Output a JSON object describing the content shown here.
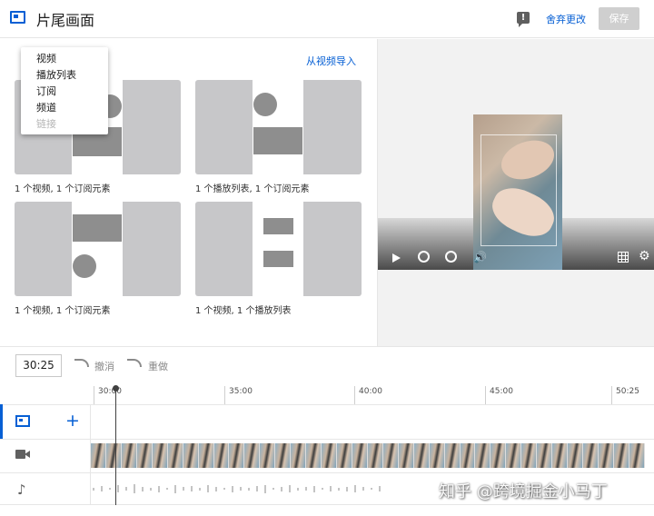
{
  "header": {
    "title": "片尾画面",
    "discard_label": "舍弃更改",
    "save_label": "保存"
  },
  "templates": {
    "import_link": "从视频导入",
    "items": [
      {
        "label": "1 个视频, 1 个订阅元素"
      },
      {
        "label": "1 个播放列表, 1 个订阅元素"
      },
      {
        "label": "1 个视频, 1 个订阅元素"
      },
      {
        "label": "1 个视频, 1 个播放列表"
      }
    ]
  },
  "menu": {
    "items": [
      {
        "label": "视频",
        "enabled": true
      },
      {
        "label": "播放列表",
        "enabled": true
      },
      {
        "label": "订阅",
        "enabled": true
      },
      {
        "label": "频道",
        "enabled": true
      },
      {
        "label": "链接",
        "enabled": false
      }
    ]
  },
  "player": {
    "icons": [
      "play-icon",
      "rewind-10-icon",
      "forward-10-icon",
      "volume-icon",
      "grid-icon",
      "settings-icon"
    ]
  },
  "timeline": {
    "current_time": "30:25",
    "undo_label": "撤消",
    "redo_label": "重做",
    "ticks": [
      "30:00",
      "35:00",
      "40:00",
      "45:00",
      "50:25"
    ]
  },
  "tracks": {
    "icons": [
      "endscreen-icon",
      "add-icon",
      "video-camera-icon",
      "music-note-icon"
    ]
  },
  "watermark": "知乎 @跨境掘金小马丁",
  "colors": {
    "accent": "#065fd4",
    "template_bg": "#c7c7c9",
    "placeholder": "#8e8e8e"
  }
}
